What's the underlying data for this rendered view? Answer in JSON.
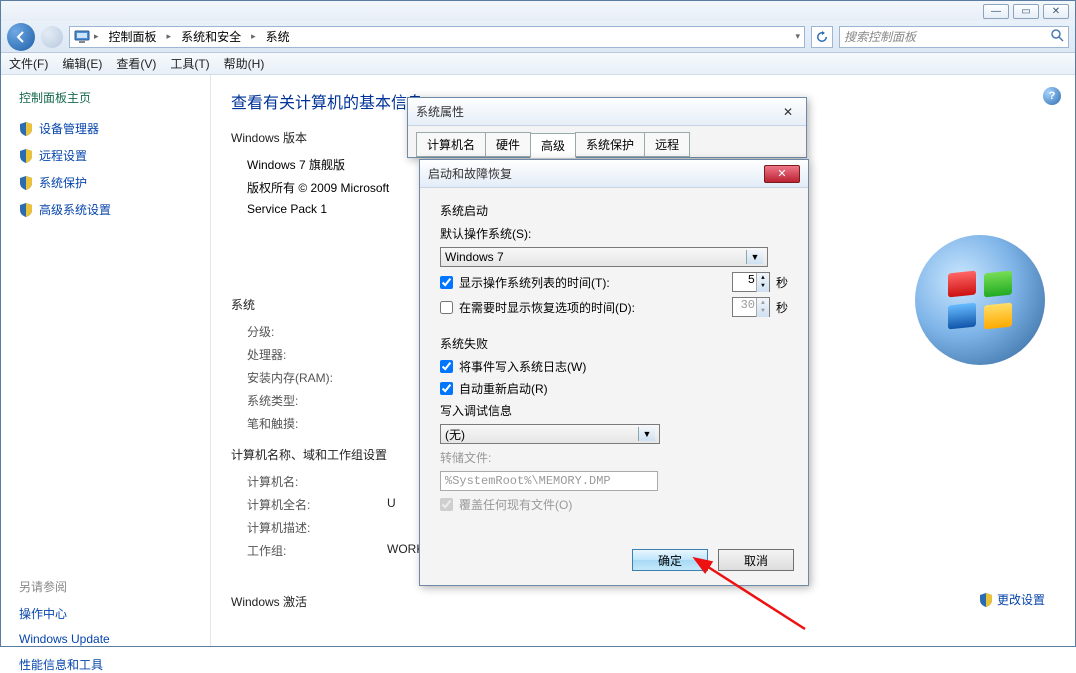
{
  "window": {
    "min": "—",
    "max": "▭",
    "close": "✕"
  },
  "breadcrumb": {
    "root_icon": "🖥",
    "items": [
      "控制面板",
      "系统和安全",
      "系统"
    ]
  },
  "search": {
    "placeholder": "搜索控制面板"
  },
  "menu": {
    "file": "文件(F)",
    "edit": "编辑(E)",
    "view": "查看(V)",
    "tools": "工具(T)",
    "help": "帮助(H)"
  },
  "sidebar": {
    "home": "控制面板主页",
    "links": [
      "设备管理器",
      "远程设置",
      "系统保护",
      "高级系统设置"
    ],
    "seealso_title": "另请参阅",
    "seealso": [
      "操作中心",
      "Windows Update",
      "性能信息和工具"
    ]
  },
  "main": {
    "title": "查看有关计算机的基本信息",
    "ver_section": "Windows 版本",
    "edition": "Windows 7 旗舰版",
    "copyright": "版权所有 © 2009 Microsoft",
    "sp": "Service Pack 1",
    "sys_section": "系统",
    "fields": {
      "rating": "分级:",
      "cpu": "处理器:",
      "ram": "安装内存(RAM):",
      "systype": "系统类型:",
      "pen": "笔和触摸:"
    },
    "name_section": "计算机名称、域和工作组设置",
    "name_fields": {
      "name": {
        "label": "计算机名:",
        "value": ""
      },
      "full": {
        "label": "计算机全名:",
        "value": "U"
      },
      "desc": {
        "label": "计算机描述:",
        "value": ""
      },
      "wg": {
        "label": "工作组:",
        "value": "WORKGROUP"
      }
    },
    "act_section": "Windows 激活",
    "change_settings": "更改设置"
  },
  "sysprop": {
    "title": "系统属性",
    "tabs": [
      "计算机名",
      "硬件",
      "高级",
      "系统保护",
      "远程"
    ],
    "active_tab": 2
  },
  "startup": {
    "title": "启动和故障恢复",
    "g1_title": "系统启动",
    "default_os_label": "默认操作系统(S):",
    "default_os_value": "Windows 7",
    "show_list": {
      "checked": true,
      "label": "显示操作系统列表的时间(T):",
      "value": "5",
      "unit": "秒"
    },
    "show_recovery": {
      "checked": false,
      "label": "在需要时显示恢复选项的时间(D):",
      "value": "30",
      "unit": "秒"
    },
    "g2_title": "系统失败",
    "write_log": {
      "checked": true,
      "label": "将事件写入系统日志(W)"
    },
    "auto_restart": {
      "checked": true,
      "label": "自动重新启动(R)"
    },
    "debug_label": "写入调试信息",
    "debug_value": "(无)",
    "dump_label": "转储文件:",
    "dump_value": "%SystemRoot%\\MEMORY.DMP",
    "overwrite": {
      "checked": true,
      "label": "覆盖任何现有文件(O)"
    },
    "ok": "确定",
    "cancel": "取消"
  }
}
